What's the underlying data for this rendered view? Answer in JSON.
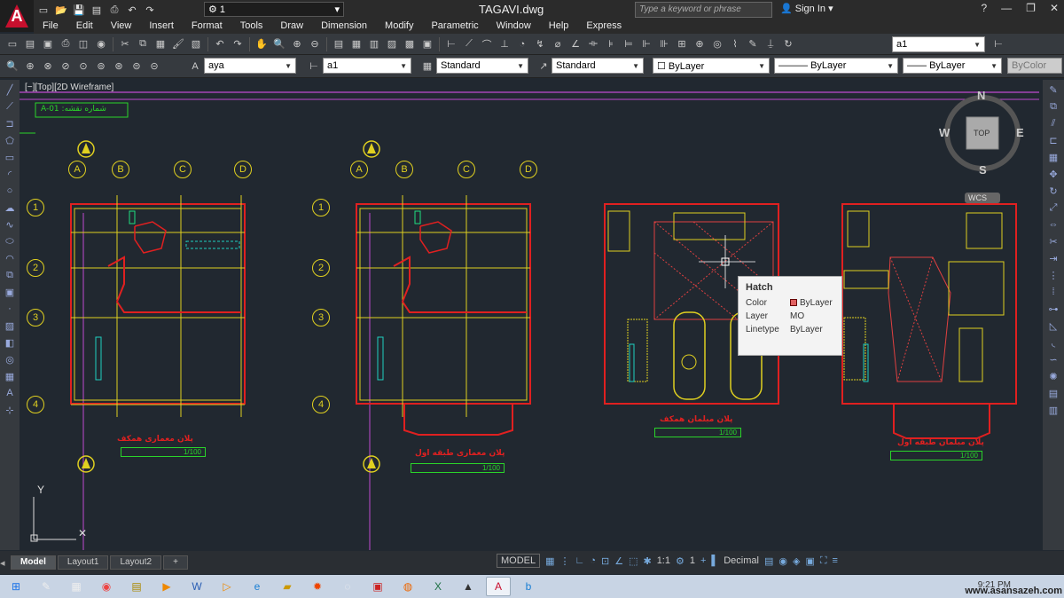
{
  "app": {
    "file_title": "TAGAVI.dwg",
    "workspace": "1",
    "search_placeholder": "Type a keyword or phrase",
    "sign_in": "Sign In"
  },
  "menu": [
    "File",
    "Edit",
    "View",
    "Insert",
    "Format",
    "Tools",
    "Draw",
    "Dimension",
    "Modify",
    "Parametric",
    "Window",
    "Help",
    "Express"
  ],
  "toolbar2": {
    "layer_combo": "a1"
  },
  "toolbar3": {
    "text_style": "aya",
    "dim_style": "a1",
    "table_style": "Standard",
    "mleader_style": "Standard",
    "layer": "ByLayer",
    "linetype": "ByLayer",
    "lineweight": "ByLayer",
    "color": "ByColor"
  },
  "viewport": {
    "label": "[−][Top][2D Wireframe]",
    "sheet_label": "A-01 :شماره نقشه"
  },
  "viewcube": {
    "n": "N",
    "s": "S",
    "e": "E",
    "w": "W",
    "top": "TOP",
    "wcs": "WCS"
  },
  "ucs": {
    "y": "Y"
  },
  "plans": [
    {
      "title": "پلان معماری همکف",
      "scale": "1/100"
    },
    {
      "title": "پلان معماری طبقه اول",
      "scale": "1/100"
    },
    {
      "title": "پلان مبلمان همکف",
      "scale": "1/100"
    },
    {
      "title": "پلان مبلمان طبقه اول",
      "scale": "1/100"
    }
  ],
  "axes": {
    "cols": [
      "A",
      "B",
      "C",
      "D"
    ],
    "rows": [
      "1",
      "2",
      "3",
      "4"
    ]
  },
  "tooltip": {
    "title": "Hatch",
    "color_label": "Color",
    "color_value": "ByLayer",
    "layer_label": "Layer",
    "layer_value": "MO",
    "linetype_label": "Linetype",
    "linetype_value": "ByLayer"
  },
  "tabs": [
    "Model",
    "Layout1",
    "Layout2"
  ],
  "status": {
    "model": "MODEL",
    "scale": "1:1",
    "annot": "1",
    "units": "Decimal"
  },
  "taskbar": {
    "clock": "9:21 PM",
    "watermark": "www.asansazeh.com"
  }
}
